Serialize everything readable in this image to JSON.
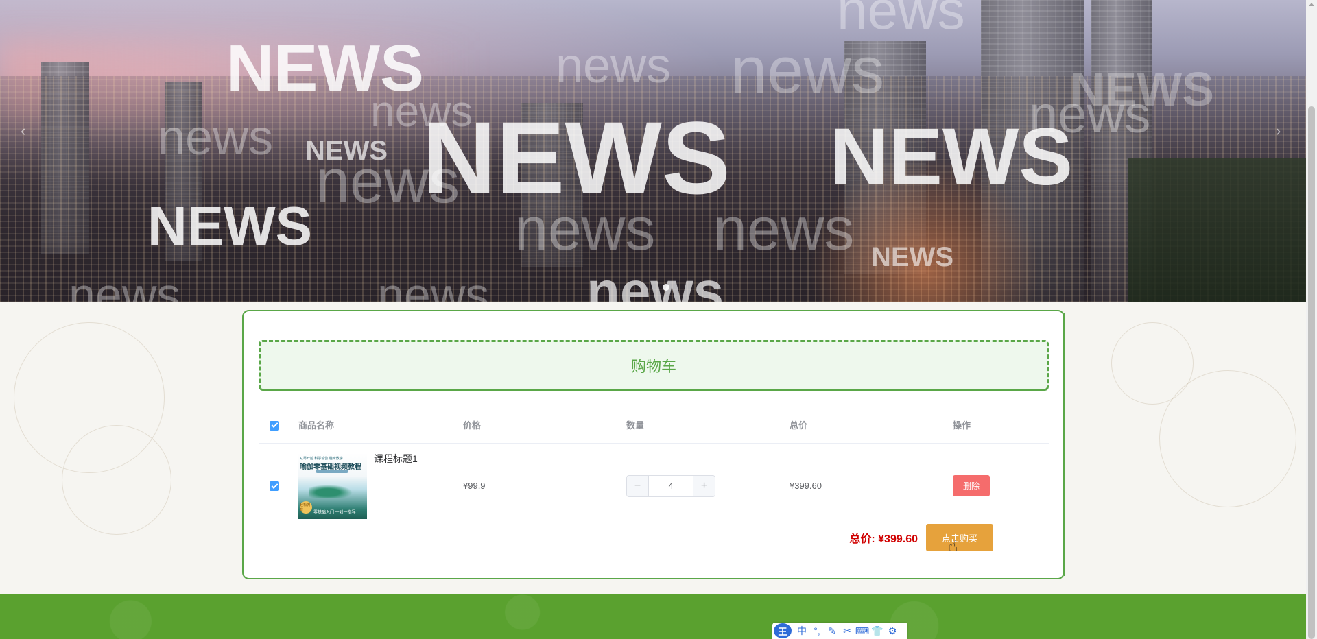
{
  "banner": {
    "watermarks": {
      "big": "NEWS",
      "small": "news"
    },
    "slide_indicator_count": 1
  },
  "cart": {
    "title": "购物车",
    "columns": {
      "name": "商品名称",
      "price": "价格",
      "quantity": "数量",
      "total": "总价",
      "actions": "操作"
    },
    "items": [
      {
        "name": "课程标题1",
        "price": "¥99.9",
        "quantity": "4",
        "total": "¥399.60",
        "delete_label": "删除",
        "thumbnail": {
          "header_text": "从零开始 科学瑜伽 趣味教学",
          "title_text": "瑜伽零基础视频教程",
          "badge_text": "轻松拥有",
          "footer_text": "零基础入门 一对一指导"
        }
      }
    ],
    "summary": {
      "total_label": "总价: ¥399.60",
      "buy_label": "点击购买"
    }
  },
  "ime": {
    "logo": "王",
    "mode": "中",
    "icons": [
      "punctuation-icon",
      "pen-icon",
      "scissors-icon",
      "keyboard-icon",
      "skin-icon",
      "settings-icon"
    ]
  },
  "colors": {
    "brand_green": "#5aa748",
    "footer_green": "#5aa12f",
    "buy_orange": "#e6a23c",
    "delete_red": "#f56c6c",
    "total_red": "#d00000",
    "checkbox_blue": "#409eff"
  }
}
